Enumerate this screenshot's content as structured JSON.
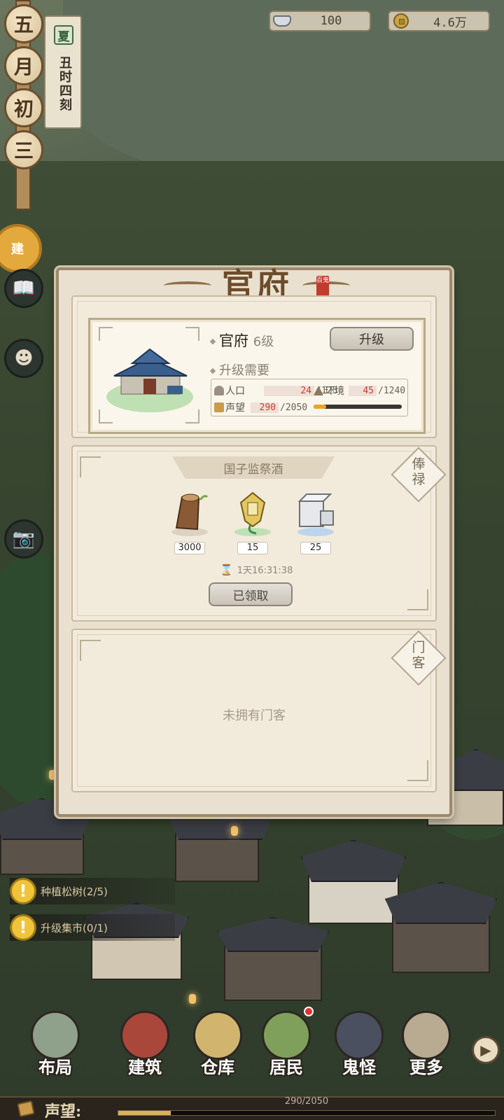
{
  "top_bar": {
    "silver": {
      "icon": "silver-ingot-icon",
      "value": "100"
    },
    "coins": {
      "icon": "copper-coin-icon",
      "value": "4.6万"
    }
  },
  "calendar": {
    "date_chars": [
      "五",
      "月",
      "初",
      "三"
    ],
    "season": "夏",
    "time": "丑时四刻"
  },
  "side_buttons": {
    "build_label": "建",
    "camera_icon": "camera-icon",
    "book_icon": "book-icon",
    "character_icon": "character-icon"
  },
  "dialog": {
    "title": "官府",
    "seal": "百鬼",
    "building": {
      "name": "官府",
      "level": "6级",
      "upgrade_label": "升级",
      "req_title": "升级需要",
      "requirements": {
        "population": {
          "label": "人口",
          "current": "24",
          "total": "/125"
        },
        "environment": {
          "label": "环境",
          "current": "45",
          "total": "/1240"
        },
        "reputation": {
          "label": "声望",
          "current": "290",
          "total": "/2050",
          "progress": 0.14
        }
      }
    },
    "salary": {
      "tag": "俸禄",
      "header": "国子监祭酒",
      "rewards": [
        {
          "name": "wood-log",
          "qty": "3000"
        },
        {
          "name": "jade-token",
          "qty": "15"
        },
        {
          "name": "stone-block",
          "qty": "25"
        }
      ],
      "timer": "1天16:31:38",
      "claimed_label": "已领取"
    },
    "retainers": {
      "tag": "门客",
      "empty_text": "未拥有门客"
    }
  },
  "quests": [
    {
      "text": "种植松树(2/5)"
    },
    {
      "text": "升级集市(0/1)"
    }
  ],
  "bottom_nav": [
    {
      "label": "布局"
    },
    {
      "label": "建筑"
    },
    {
      "label": "仓库"
    },
    {
      "label": "居民"
    },
    {
      "label": "鬼怪"
    },
    {
      "label": "更多"
    }
  ],
  "reputation_bar": {
    "label": "声望:",
    "value": "290/2050",
    "progress": 0.14
  },
  "colors": {
    "accent_gold": "#e8a52c",
    "alert_red": "#d23a2e",
    "panel_bg": "#f2ebdc"
  }
}
